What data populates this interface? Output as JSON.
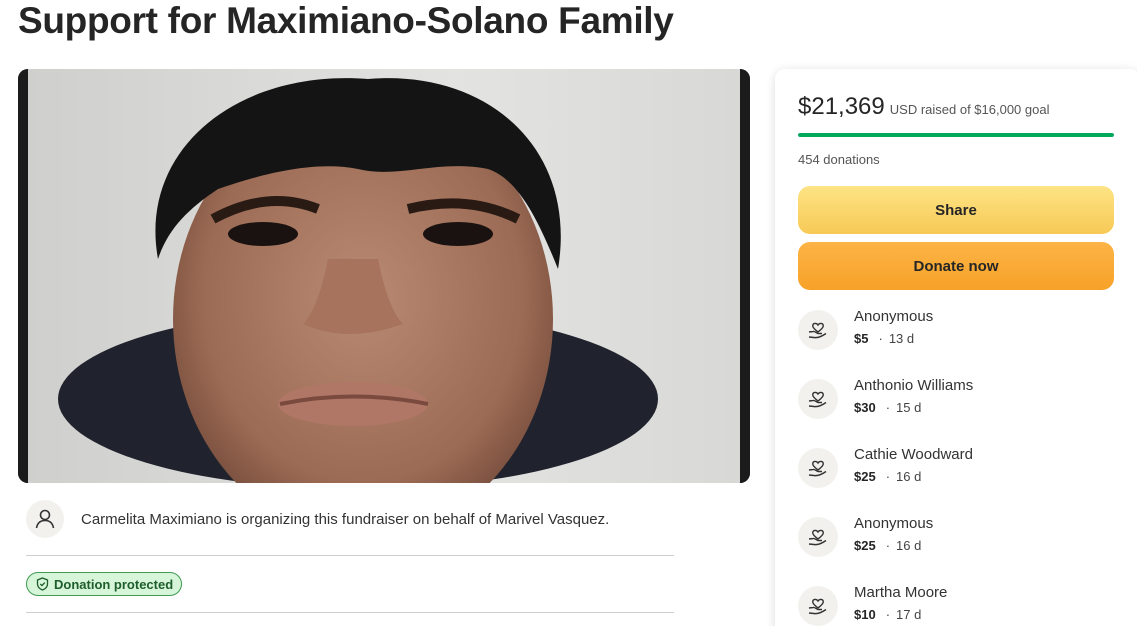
{
  "title": "Support for Maximiano-Solano Family",
  "organizer": {
    "text": "Carmelita Maximiano is organizing this fundraiser on behalf of Marivel Vasquez."
  },
  "badge": {
    "label": "Donation protected"
  },
  "progress": {
    "amount": "$21,369",
    "text": "USD raised of $16,000 goal",
    "fraction": 1.0,
    "donations": "454 donations"
  },
  "buttons": {
    "share": "Share",
    "donate": "Donate now"
  },
  "donors": [
    {
      "name": "Anonymous",
      "amount": "$5",
      "time": "13 d"
    },
    {
      "name": "Anthonio Williams",
      "amount": "$30",
      "time": "15 d"
    },
    {
      "name": "Cathie Woodward",
      "amount": "$25",
      "time": "16 d"
    },
    {
      "name": "Anonymous",
      "amount": "$25",
      "time": "16 d"
    },
    {
      "name": "Martha Moore",
      "amount": "$10",
      "time": "17 d"
    }
  ],
  "colors": {
    "progress": "#02a95c",
    "share_button": "#f7c956",
    "donate_button": "#f7a128",
    "badge_bg": "#d7f5d9"
  },
  "icons": {
    "organizer": "user-icon",
    "badge": "shield-icon",
    "donor": "heart-hand-icon"
  }
}
